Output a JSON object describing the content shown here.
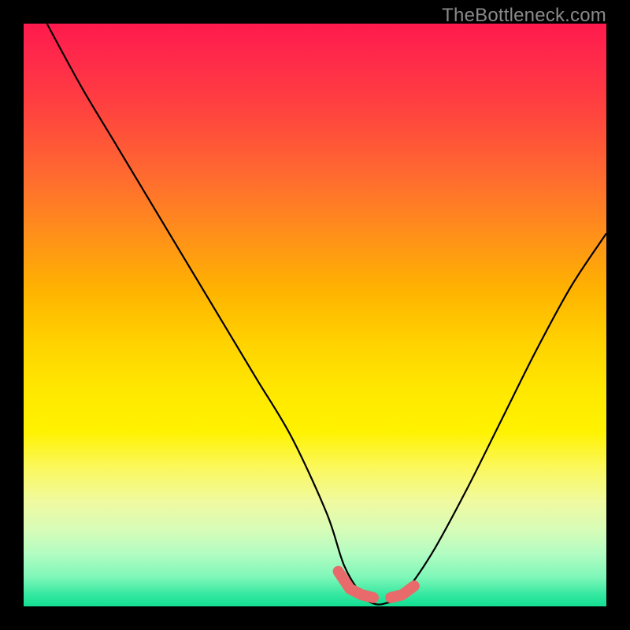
{
  "watermark": "TheBottleneck.com",
  "colors": {
    "frame_bg": "#000000",
    "curve_stroke": "#000000",
    "marker_fill": "#e86a6a",
    "marker_stroke": "#b24c4c"
  },
  "chart_data": {
    "type": "line",
    "title": "",
    "xlabel": "",
    "ylabel": "",
    "xlim": [
      0,
      100
    ],
    "ylim": [
      0,
      100
    ],
    "grid": false,
    "legend": false,
    "series": [
      {
        "name": "bottleneck-curve",
        "x": [
          4,
          10,
          16,
          22,
          28,
          34,
          40,
          46,
          52,
          55,
          58,
          60,
          62,
          65,
          70,
          76,
          82,
          88,
          94,
          100
        ],
        "values": [
          100,
          89,
          79,
          69,
          59,
          49,
          39,
          29,
          16,
          7,
          2,
          0.5,
          0.5,
          2,
          9,
          20,
          32,
          44,
          55,
          64
        ]
      }
    ],
    "markers": [
      {
        "name": "left-foot",
        "points": [
          {
            "x": 54,
            "y": 6
          },
          {
            "x": 56,
            "y": 3
          },
          {
            "x": 58,
            "y": 2
          },
          {
            "x": 60,
            "y": 1.5
          }
        ]
      },
      {
        "name": "right-foot",
        "points": [
          {
            "x": 63,
            "y": 1.5
          },
          {
            "x": 65,
            "y": 2
          },
          {
            "x": 67,
            "y": 3.5
          }
        ]
      }
    ]
  }
}
